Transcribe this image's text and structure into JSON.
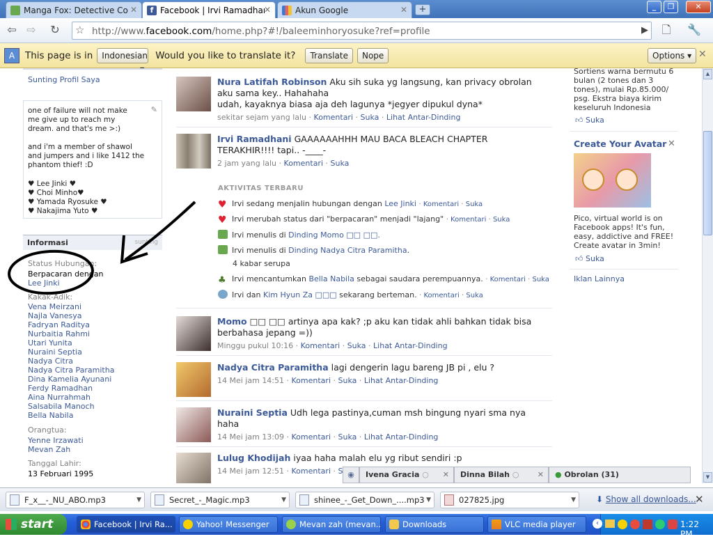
{
  "tabs": [
    {
      "label": "Manga Fox: Detective Con...",
      "active": false
    },
    {
      "label": "Facebook | Irvi Ramadhani",
      "active": true
    },
    {
      "label": "Akun Google",
      "active": false
    }
  ],
  "address": {
    "prefix": "http://www.",
    "host": "facebook.com",
    "path": "/home.php?#!/baleeminhoryosuke?ref=profile"
  },
  "translate_bar": {
    "text1": "This page is in",
    "language": "Indonesian",
    "question": "Would you like to translate it?",
    "translate_btn": "Translate",
    "nope_btn": "Nope",
    "options_btn": "Options"
  },
  "left": {
    "edit_profile": "Sunting Profil Saya",
    "bio": "one of failure will not make me give up to reach my dream. and that's me >:)",
    "bio2": "and i'm a member of shawol and jumpers and i like 1412 the phantom thief! :D",
    "bio_names": [
      "♥ Lee Jinki ♥",
      "♥ Choi Minho♥",
      "♥ Yamada Ryosuke ♥",
      "♥ Nakajima Yuto ♥"
    ],
    "info_title": "Informasi",
    "edit_label": "sunting",
    "status_label": "Status Hubungan:",
    "status_value": "Berpacaran dengan",
    "status_partner": "Lee Jinki",
    "siblings_label": "Kakak-Adik:",
    "siblings": [
      "Vena Meirzani",
      "Najla Vanesya",
      "Fadryan Raditya",
      "Nurbaitia Rahmi",
      "Utari Yunita",
      "Nuraini Septia",
      "Nadya Citra",
      "Nadya Citra Paramitha",
      "Dina Kamelia Ayunani",
      "Ferdy Ramadhan",
      "Aina Nurrahmah",
      "Salsabila Manoch",
      "Bella Nabila"
    ],
    "parents_label": "Orangtua:",
    "parents": [
      "Yenne Irzawati",
      "Mevan Zah"
    ],
    "birthday_label": "Tanggal Lahir:",
    "birthday": "13 Februari 1995"
  },
  "posts": [
    {
      "name": "Nura Latifah Robinson",
      "text": "Aku sih suka yg langsung, kan privacy obrolan aku sama key.. Hahahaha",
      "text2": "udah, kayaknya biasa aja deh lagunya *jegyer dipukul dyna*",
      "time": "sekitar sejam yang lalu",
      "comment": "Komentari",
      "like": "Suka",
      "wall": "Lihat Antar-Dinding"
    },
    {
      "name": "Irvi Ramadhani",
      "text": "GAAAAAAHHH MAU BACA BLEACH CHAPTER TERAKHIR!!!! tapi.. -____-",
      "time": "2 jam yang lalu",
      "comment": "Komentari",
      "like": "Suka"
    },
    {
      "name": "Momo",
      "text": "□□ □□ artinya apa kak? ;p aku kan tidak ahli bahkan tidak bisa berbahasa jepang =))",
      "time": "Minggu pukul 10:16",
      "comment": "Komentari",
      "like": "Suka",
      "wall": "Lihat Antar-Dinding"
    },
    {
      "name": "Nadya Citra Paramitha",
      "text": "lagi dengerin lagu bareng JB pi , elu ?",
      "time": "14 Mei jam 14:51",
      "comment": "Komentari",
      "like": "Suka",
      "wall": "Lihat Antar-Dinding"
    },
    {
      "name": "Nuraini Septia",
      "text": "Udh lega pastinya,cuman msh bingung nyari sma nya haha",
      "time": "14 Mei jam 13:09",
      "comment": "Komentari",
      "like": "Suka",
      "wall": "Lihat Antar-Dinding"
    },
    {
      "name": "Lulug Khodijah",
      "text": "iyaa haha malah elu yg ribut sendiri :p",
      "time": "14 Mei jam 12:51",
      "comment": "Komentari",
      "like": "Suka"
    }
  ],
  "activity": {
    "title": "AKTIVITAS TERBARU",
    "items": [
      {
        "pre": "Irvi sedang menjalin hubungan dengan ",
        "link": "Lee Jinki",
        "post": "",
        "c": "Komentari",
        "l": "Suka"
      },
      {
        "pre": "Irvi merubah status dari \"berpacaran\" menjadi \"lajang\"",
        "link": "",
        "post": "",
        "c": "Komentari",
        "l": "Suka"
      },
      {
        "pre": "Irvi menulis di ",
        "link": "Dinding Momo □□ □□.",
        "post": "",
        "c": "",
        "l": ""
      },
      {
        "pre": "Irvi menulis di ",
        "link": "Dinding Nadya Citra Paramitha",
        "post": ".",
        "c": "",
        "l": ""
      },
      {
        "pre": "",
        "link": "4 kabar serupa",
        "post": "",
        "c": "",
        "l": ""
      },
      {
        "pre": "Irvi mencantumkan ",
        "link": "Bella Nabila",
        "post": " sebagai saudara perempuannya.",
        "c": "Komentari",
        "l": "Suka"
      },
      {
        "pre": "Irvi dan ",
        "link": "Kim Hyun Za □□□",
        "post": " sekarang berteman.",
        "c": "Komentari",
        "l": "Suka"
      }
    ]
  },
  "right": {
    "ad1_text": "Sortiens warna bermutu 6 bulan (2 tones dan 3 tones), mulai Rp.85.000/ psg. Ekstra biaya kirim keseluruh Indonesia",
    "like": "Suka",
    "ad2_title": "Create Your Avatar",
    "ad2_text": "Pico, virtual world is on Facebook apps! It's fun, easy, addictive and FREE! Create avatar in 3min!",
    "more_ads": "Iklan Lainnya"
  },
  "chat": {
    "tab1": "Ivena Gracia",
    "tab2": "Dinna Bilah",
    "main": "Obrolan (31)"
  },
  "downloads": {
    "items": [
      "F_x__-_NU_ABO.mp3",
      "Secret_-_Magic.mp3",
      "shinee_-_Get_Down_....mp3",
      "027825.jpg"
    ],
    "show_all": "Show all downloads..."
  },
  "taskbar": {
    "start": "start",
    "items": [
      "Facebook | Irvi Ra...",
      "Yahoo! Messenger",
      "Mevan zah (mevan...",
      "Downloads",
      "VLC media player"
    ],
    "clock": "1:22 PM"
  }
}
